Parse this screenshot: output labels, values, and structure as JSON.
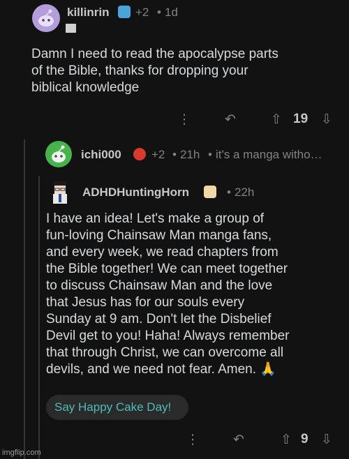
{
  "comment1": {
    "username": "killinrin",
    "score_badge": "+2",
    "time": "1d",
    "text": "Damn I need to read the apocalypse parts\nof the Bible, thanks for dropping your\nbiblical knowledge",
    "votes": "19",
    "more_glyph": "⋮",
    "reply_glyph": "↶",
    "up_glyph": "⇧",
    "down_glyph": "⇩"
  },
  "comment2": {
    "username": "ichi000",
    "score_badge": "+2",
    "time": "21h",
    "preview": "it's a manga witho…"
  },
  "comment3": {
    "username": "ADHDHuntingHorn",
    "time": "22h",
    "text": "I have an idea! Let's make a group of\nfun-loving Chainsaw Man manga fans,\nand every week, we read chapters from\nthe Bible together! We can meet together\nto discuss Chainsaw Man and the love\nthat Jesus has for our souls every\nSunday at 9 am. Don't let the Disbelief\nDevil get to you! Haha! Always remember\nthat through Christ, we can overcome all\ndevils, and we need not fear. Amen. 🙏",
    "cake_day_button": "Say Happy Cake Day!",
    "votes": "9",
    "more_glyph": "⋮",
    "reply_glyph": "↶",
    "up_glyph": "⇧",
    "down_glyph": "⇩"
  },
  "watermark": "imgflip.com",
  "separator": "•",
  "colors": {
    "background": "#121212",
    "text": "#d7dadc",
    "muted": "#818384",
    "accent_teal": "#4fbcb9"
  }
}
